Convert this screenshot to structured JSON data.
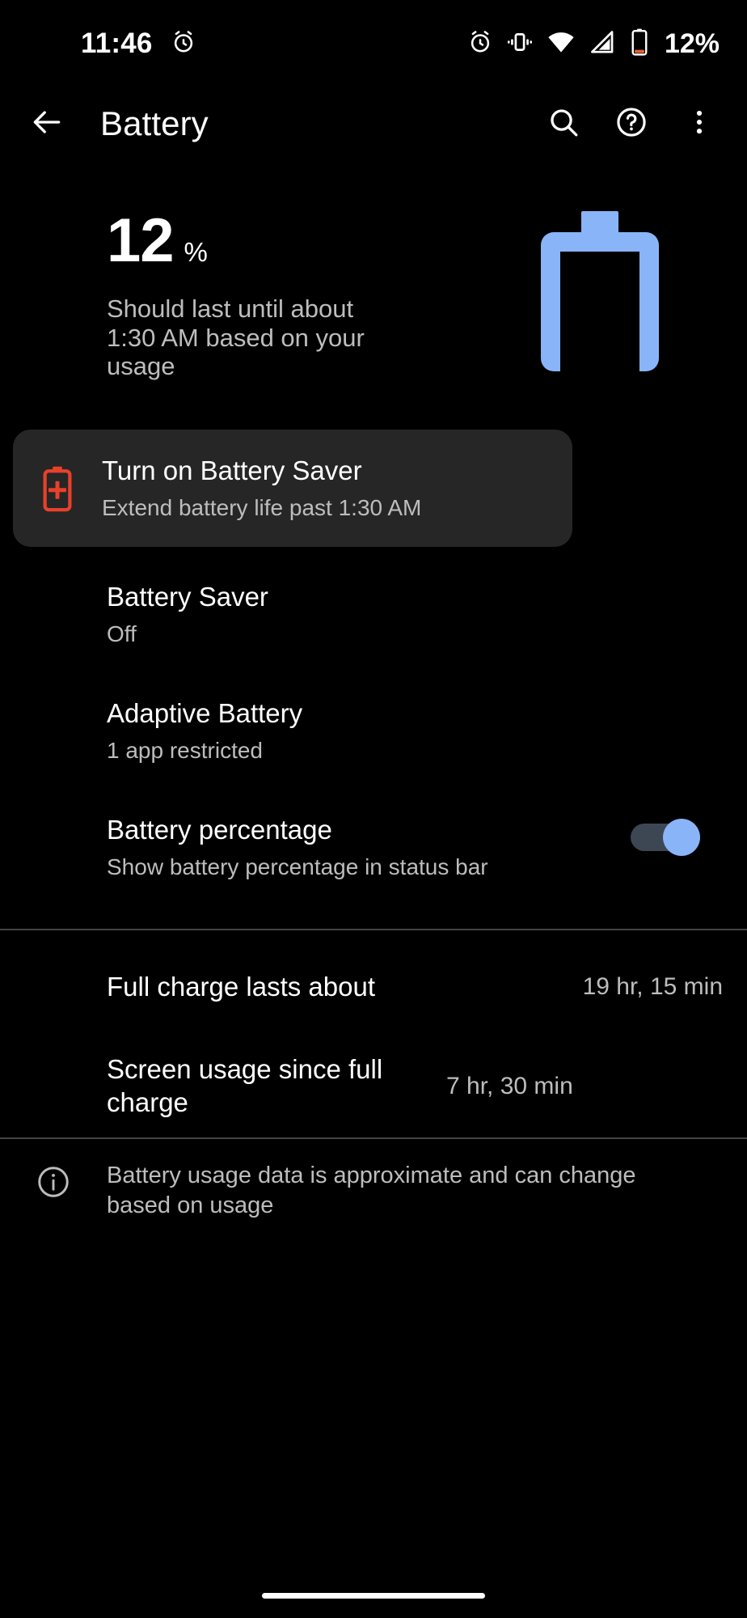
{
  "status_bar": {
    "time": "11:46",
    "battery_percent": "12%",
    "icons": [
      "alarm-icon",
      "alarm-icon",
      "vibrate-icon",
      "wifi-icon",
      "cell-signal-icon",
      "battery-icon"
    ]
  },
  "app_bar": {
    "back_icon": "back-arrow-icon",
    "title": "Battery",
    "search_icon": "search-icon",
    "help_icon": "help-circle-icon",
    "overflow_icon": "more-vert-icon"
  },
  "hero": {
    "percent_number": "12",
    "percent_symbol": "%",
    "estimate": "Should last until about 1:30 AM based on your usage",
    "battery_graphic_color": "#8ab4f8"
  },
  "suggestion_card": {
    "icon": "battery-saver-icon",
    "icon_color": "#e8412a",
    "title": "Turn on Battery Saver",
    "subtitle": "Extend battery life past 1:30 AM",
    "background": "#262626"
  },
  "preferences": [
    {
      "title": "Battery Saver",
      "summary": "Off"
    },
    {
      "title": "Adaptive Battery",
      "summary": "1 app restricted"
    },
    {
      "title": "Battery percentage",
      "summary": "Show battery percentage in status bar",
      "toggle": "on",
      "toggle_color": "#8ab4f8"
    }
  ],
  "stats": [
    {
      "label": "Full charge lasts about",
      "value": "19 hr, 15 min"
    },
    {
      "label": "Screen usage since full charge",
      "value": "7 hr, 30 min"
    }
  ],
  "footer": {
    "icon": "info-icon",
    "text": "Battery usage data is approximate and can change based on usage"
  }
}
